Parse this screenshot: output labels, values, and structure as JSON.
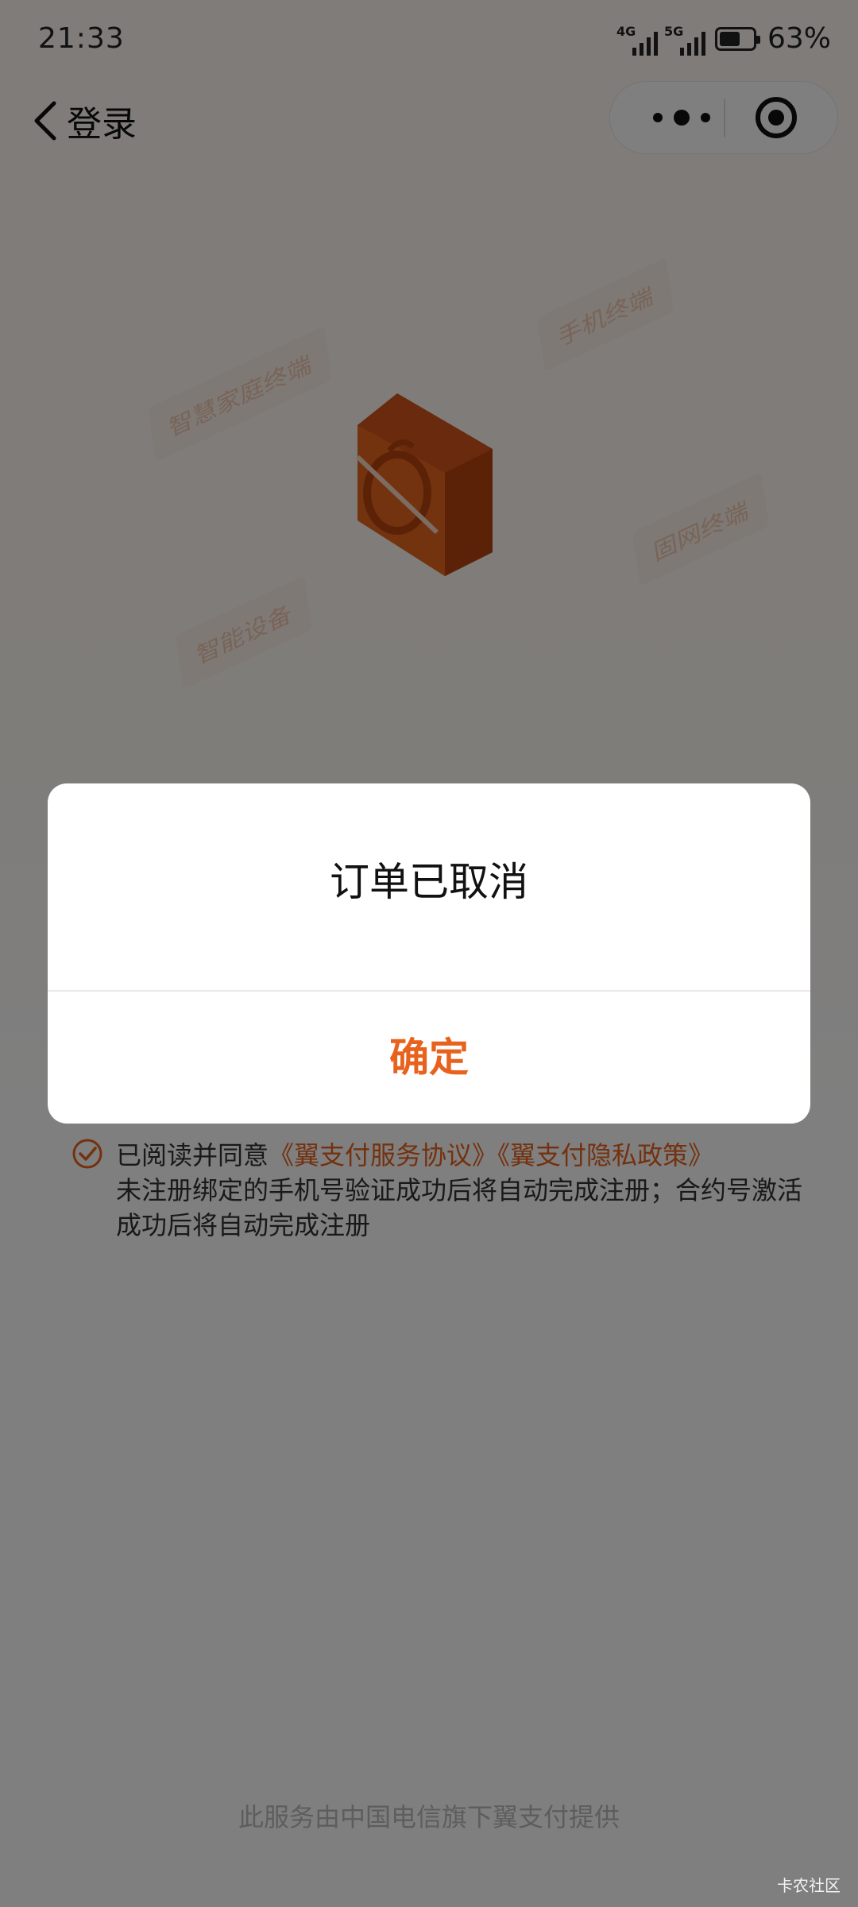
{
  "status_bar": {
    "time": "21:33",
    "net_1": "4G",
    "net_2": "5G",
    "battery_percent": "63%",
    "battery_level": 0.63
  },
  "nav": {
    "title": "登录",
    "more_icon": "more-dots-icon",
    "close_icon": "target-circle-icon"
  },
  "hero": {
    "tags": [
      "智慧家庭终端",
      "手机终端",
      "固网终端",
      "智能设备"
    ]
  },
  "agreement": {
    "prefix": "已阅读并同意",
    "link_1": "《翼支付服务协议》",
    "link_2": "《翼支付隐私政策》",
    "note": "未注册绑定的手机号验证成功后将自动完成注册；合约号激活成功后将自动完成注册"
  },
  "footer": "此服务由中国电信旗下翼支付提供",
  "dialog": {
    "message": "订单已取消",
    "confirm": "确定"
  },
  "watermark": "卡农社区",
  "colors": {
    "accent": "#e8621d",
    "overlay": "rgba(0,0,0,0.5)"
  }
}
